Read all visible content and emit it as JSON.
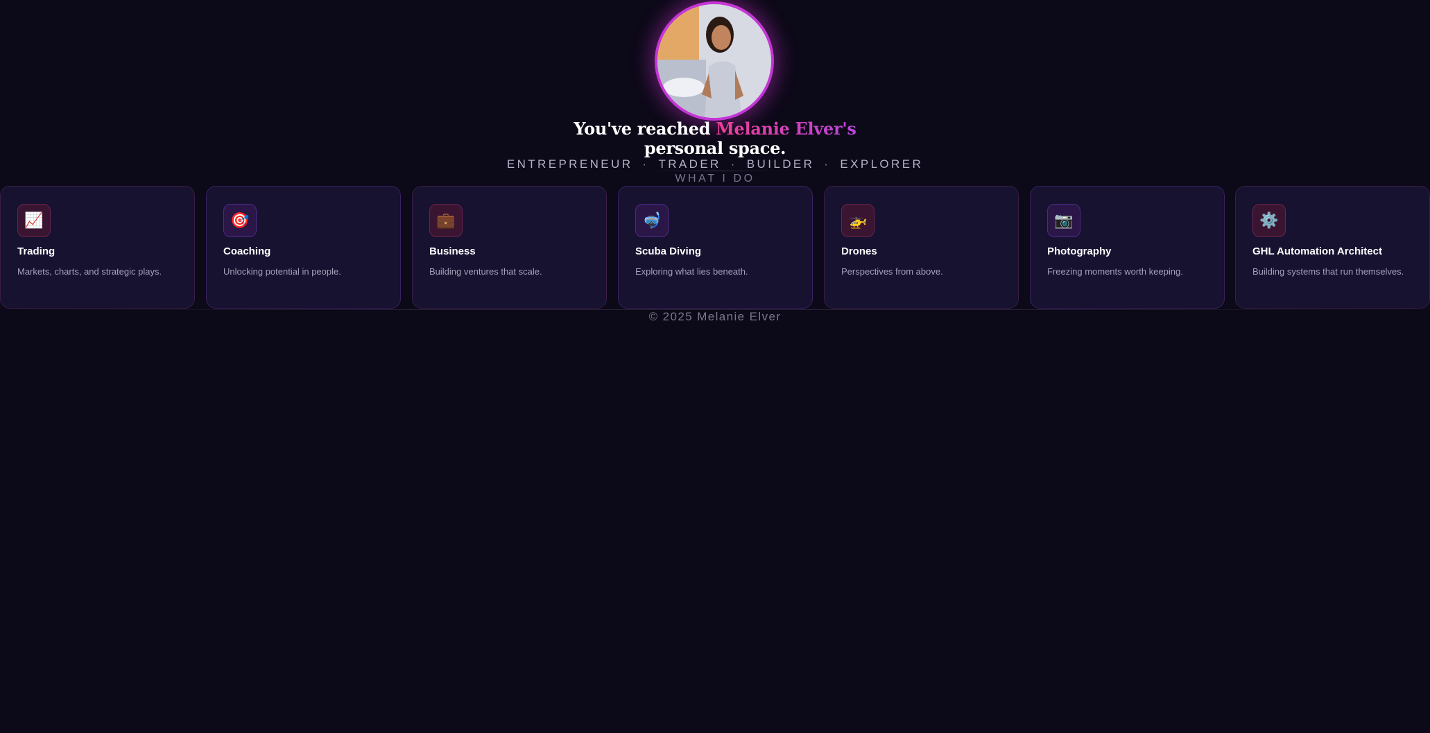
{
  "hero": {
    "avatar_alt": "Melanie Elver",
    "headline_lead": "You've reached ",
    "headline_name": "Melanie Elver's",
    "headline_tail": "personal space.",
    "roles": [
      "ENTREPRENEUR",
      "TRADER",
      "BUILDER",
      "EXPLORER"
    ],
    "role_separator": "·"
  },
  "section": {
    "label": "WHAT I DO"
  },
  "cards": [
    {
      "title": "Trading",
      "desc": "Markets, charts, and strategic plays.",
      "icon": "chart-increasing-icon",
      "glyph": "📈",
      "tone": "pink"
    },
    {
      "title": "Coaching",
      "desc": "Unlocking potential in people.",
      "icon": "target-icon",
      "glyph": "🎯",
      "tone": "purple"
    },
    {
      "title": "Business",
      "desc": "Building ventures that scale.",
      "icon": "briefcase-icon",
      "glyph": "💼",
      "tone": "pink"
    },
    {
      "title": "Scuba Diving",
      "desc": "Exploring what lies beneath.",
      "icon": "diving-mask-icon",
      "glyph": "🤿",
      "tone": "purple"
    },
    {
      "title": "Drones",
      "desc": "Perspectives from above.",
      "icon": "helicopter-icon",
      "glyph": "🚁",
      "tone": "pink"
    },
    {
      "title": "Photography",
      "desc": "Freezing moments worth keeping.",
      "icon": "camera-icon",
      "glyph": "📷",
      "tone": "purple"
    },
    {
      "title": "GHL Automation Architect",
      "desc": "Building systems that run themselves.",
      "icon": "gear-icon",
      "glyph": "⚙️",
      "tone": "pink"
    }
  ],
  "footer": {
    "text": "© 2025 Melanie Elver"
  },
  "colors": {
    "background": "#0c0918",
    "card": "#161230",
    "accent_pink": "#ee3f95",
    "accent_purple": "#b745d9"
  }
}
